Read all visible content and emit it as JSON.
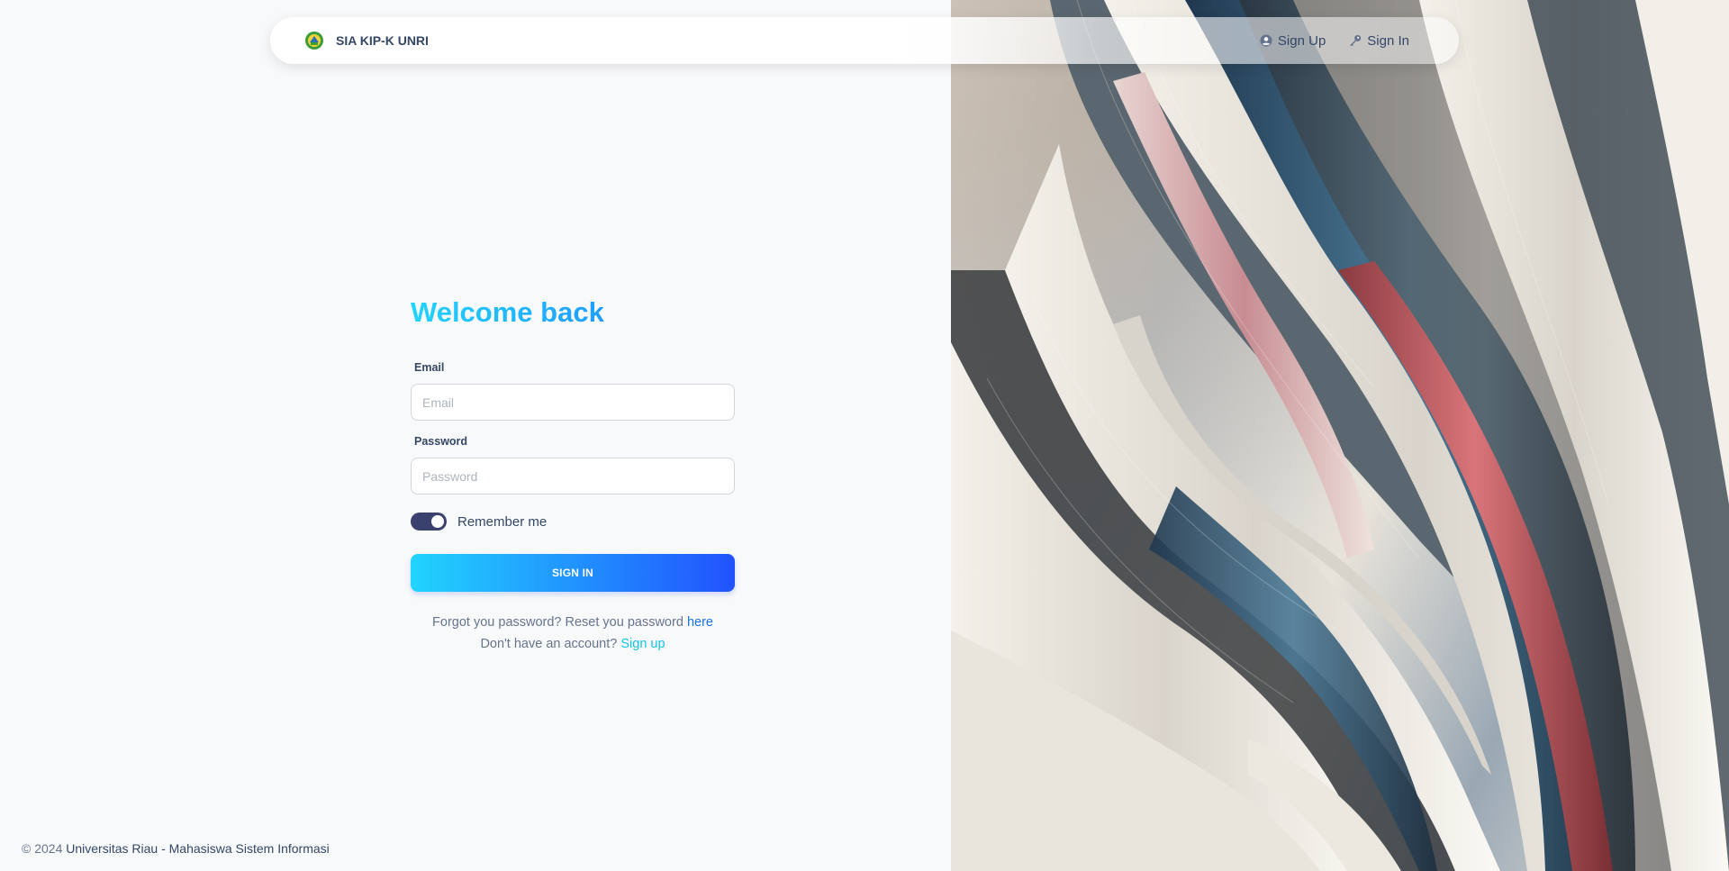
{
  "navbar": {
    "brand": "SIA KIP-K UNRI",
    "brand_icon": "university-emblem-icon",
    "links": [
      {
        "label": "Sign Up",
        "icon": "user-circle-icon"
      },
      {
        "label": "Sign In",
        "icon": "key-icon"
      }
    ]
  },
  "form": {
    "title": "Welcome back",
    "email_label": "Email",
    "email_placeholder": "Email",
    "email_value": "",
    "password_label": "Password",
    "password_placeholder": "Password",
    "password_value": "",
    "remember_label": "Remember me",
    "remember_checked": true,
    "submit_label": "SIGN IN",
    "forgot_text": "Forgot you password? Reset you password",
    "forgot_link": "here",
    "signup_text": "Don't have an account?",
    "signup_link": "Sign up"
  },
  "footer": {
    "copyright": "© 2024",
    "org": "Universitas Riau - Mahasiswa Sistem Informasi"
  },
  "colors": {
    "accent_start": "#21d4fd",
    "accent_end": "#2152ff",
    "toggle": "#3a416f",
    "text_dark": "#344767",
    "text_muted": "#67748e"
  }
}
